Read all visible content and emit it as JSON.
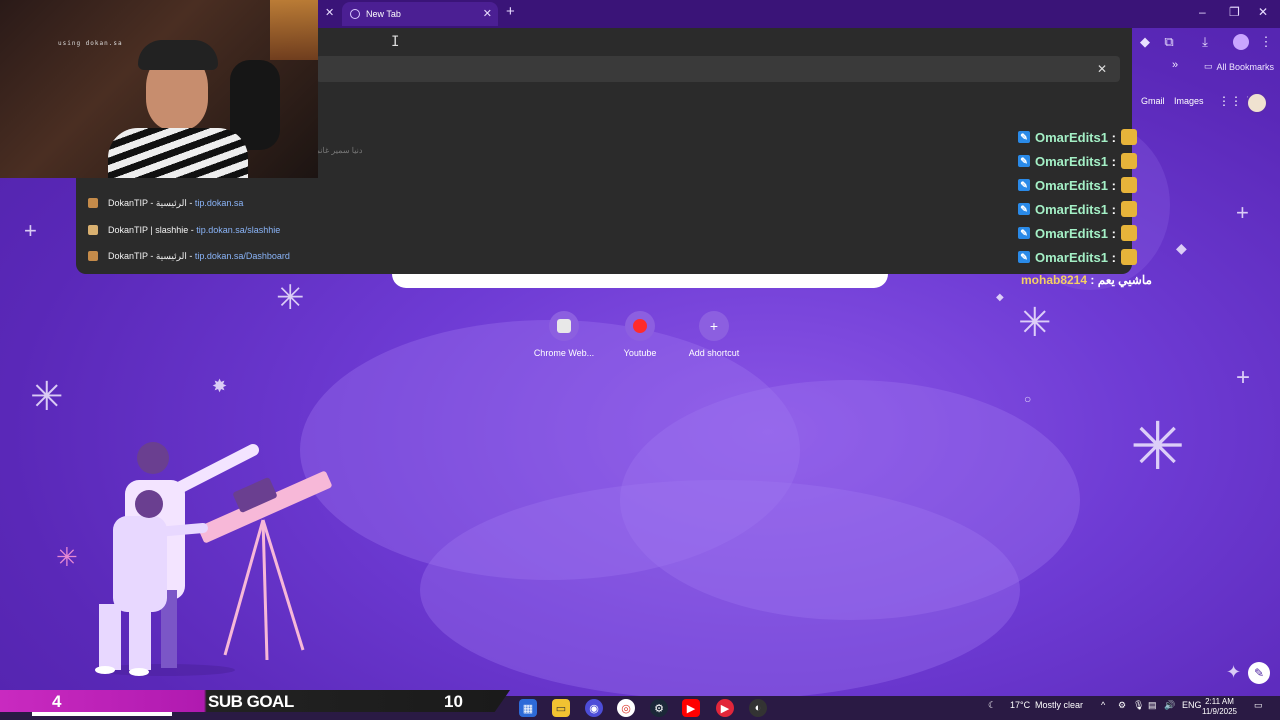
{
  "browser": {
    "tab_title": "New Tab",
    "bookmarks_label": "All Bookmarks"
  },
  "omnibox": {
    "suggestions": [
      {
        "title": "DokanTIP - الرئيسية",
        "sep": " - ",
        "url": "tip.dokan.sa"
      },
      {
        "title": "DokanTIP | slashhie",
        "sep": " - ",
        "url": "tip.dokan.sa/slashhie"
      },
      {
        "title": "DokanTIP - الرئيسية",
        "sep": " - ",
        "url": "tip.dokan.sa/Dashboard"
      }
    ],
    "faint_text": "دنيا سمير غانم"
  },
  "stream": {
    "cam_caption": "using dokan.sa",
    "chat": [
      {
        "user": "OmarEdits1",
        "sep": " :"
      },
      {
        "user": "OmarEdits1",
        "sep": " :"
      },
      {
        "user": "OmarEdits1",
        "sep": " :"
      },
      {
        "user": "OmarEdits1",
        "sep": " :"
      },
      {
        "user": "OmarEdits1",
        "sep": " :"
      },
      {
        "user": "OmarEdits1",
        "sep": " :"
      }
    ],
    "last_chat": {
      "user": "mohab8214",
      "message": " : ماشيي يعم"
    },
    "sub_goal": {
      "current": "4",
      "label": "SUB GOAL",
      "target": "10"
    }
  },
  "ntp": {
    "gmail": "Gmail",
    "images": "Images",
    "shortcuts": [
      {
        "label": "Chrome Web...",
        "color": "#e0e0e0"
      },
      {
        "label": "Youtube",
        "color": "#ff2b2b"
      },
      {
        "label": "Add shortcut",
        "color": "none"
      }
    ]
  },
  "taskbar": {
    "temperature": "17°C",
    "weather": "Mostly clear",
    "language": "ENG",
    "time": "2:11 AM",
    "date": "11/9/2025"
  }
}
